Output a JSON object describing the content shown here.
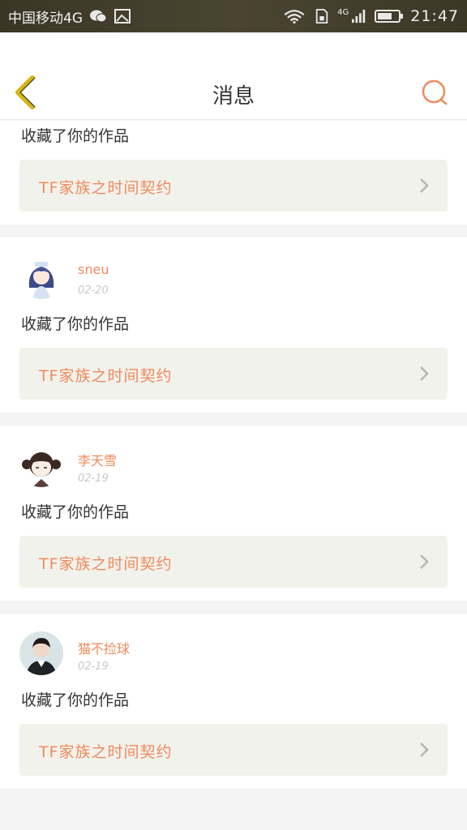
{
  "status_bar": {
    "carrier": "中国移动4G",
    "network": "4G",
    "time": "21:47"
  },
  "header": {
    "title": "消息",
    "back_icon": "chevron-left-icon",
    "search_icon": "search-icon"
  },
  "colors": {
    "accent": "#f08a5d",
    "back": "#d8b514",
    "box_bg": "#f2f2ec"
  },
  "messages": [
    {
      "action": "收藏了你的作品",
      "work": "TF家族之时间契约"
    },
    {
      "username": "sneu",
      "date": "02-20",
      "action": "收藏了你的作品",
      "work": "TF家族之时间契约"
    },
    {
      "username": "李天雪",
      "date": "02-19",
      "action": "收藏了你的作品",
      "work": "TF家族之时间契约"
    },
    {
      "username": "猫不捡球",
      "date": "02-19",
      "action": "收藏了你的作品",
      "work": "TF家族之时间契约"
    }
  ]
}
